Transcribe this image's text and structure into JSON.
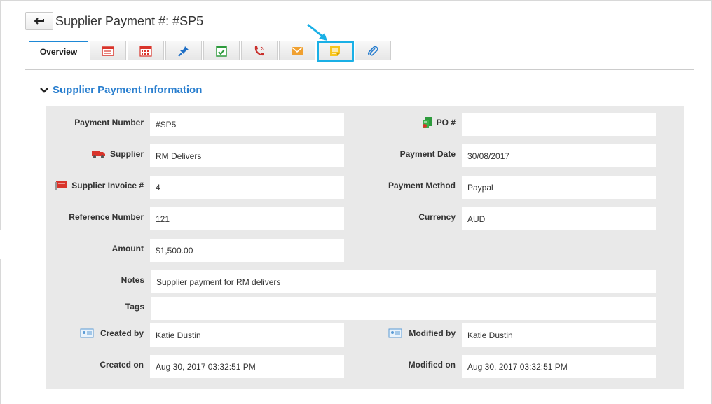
{
  "header": {
    "back_label": "←",
    "title": "Supplier Payment #: #SP5"
  },
  "tabs": [
    {
      "label": "Overview",
      "icon": "overview"
    },
    {
      "label": "",
      "icon": "list-icon"
    },
    {
      "label": "",
      "icon": "calendar-icon"
    },
    {
      "label": "",
      "icon": "pin-icon"
    },
    {
      "label": "",
      "icon": "task-check-icon"
    },
    {
      "label": "",
      "icon": "phone-call-icon"
    },
    {
      "label": "",
      "icon": "email-icon"
    },
    {
      "label": "",
      "icon": "note-icon"
    },
    {
      "label": "",
      "icon": "attachment-icon"
    }
  ],
  "section": {
    "title": "Supplier Payment Information"
  },
  "fields": {
    "payment_number": {
      "label": "Payment Number",
      "value": "#SP5"
    },
    "po": {
      "label": "PO #",
      "value": ""
    },
    "supplier": {
      "label": "Supplier",
      "value": "RM Delivers"
    },
    "payment_date": {
      "label": "Payment Date",
      "value": "30/08/2017"
    },
    "supplier_invoice": {
      "label": "Supplier Invoice #",
      "value": "4"
    },
    "payment_method": {
      "label": "Payment Method",
      "value": "Paypal"
    },
    "reference_number": {
      "label": "Reference Number",
      "value": "121"
    },
    "currency": {
      "label": "Currency",
      "value": "AUD"
    },
    "amount": {
      "label": "Amount",
      "value": "$1,500.00"
    },
    "notes": {
      "label": "Notes",
      "value": "Supplier payment for RM delivers"
    },
    "tags": {
      "label": "Tags",
      "value": ""
    },
    "created_by": {
      "label": "Created by",
      "value": "Katie Dustin"
    },
    "modified_by": {
      "label": "Modified by",
      "value": "Katie Dustin"
    },
    "created_on": {
      "label": "Created on",
      "value": "Aug 30, 2017 03:32:51 PM"
    },
    "modified_on": {
      "label": "Modified on",
      "value": "Aug 30, 2017 03:32:51 PM"
    }
  },
  "colors": {
    "accent": "#2a7fcf",
    "tab_active_border": "#1e88d6",
    "highlight": "#1ab0e6",
    "panel_bg": "#e9e9e9"
  }
}
